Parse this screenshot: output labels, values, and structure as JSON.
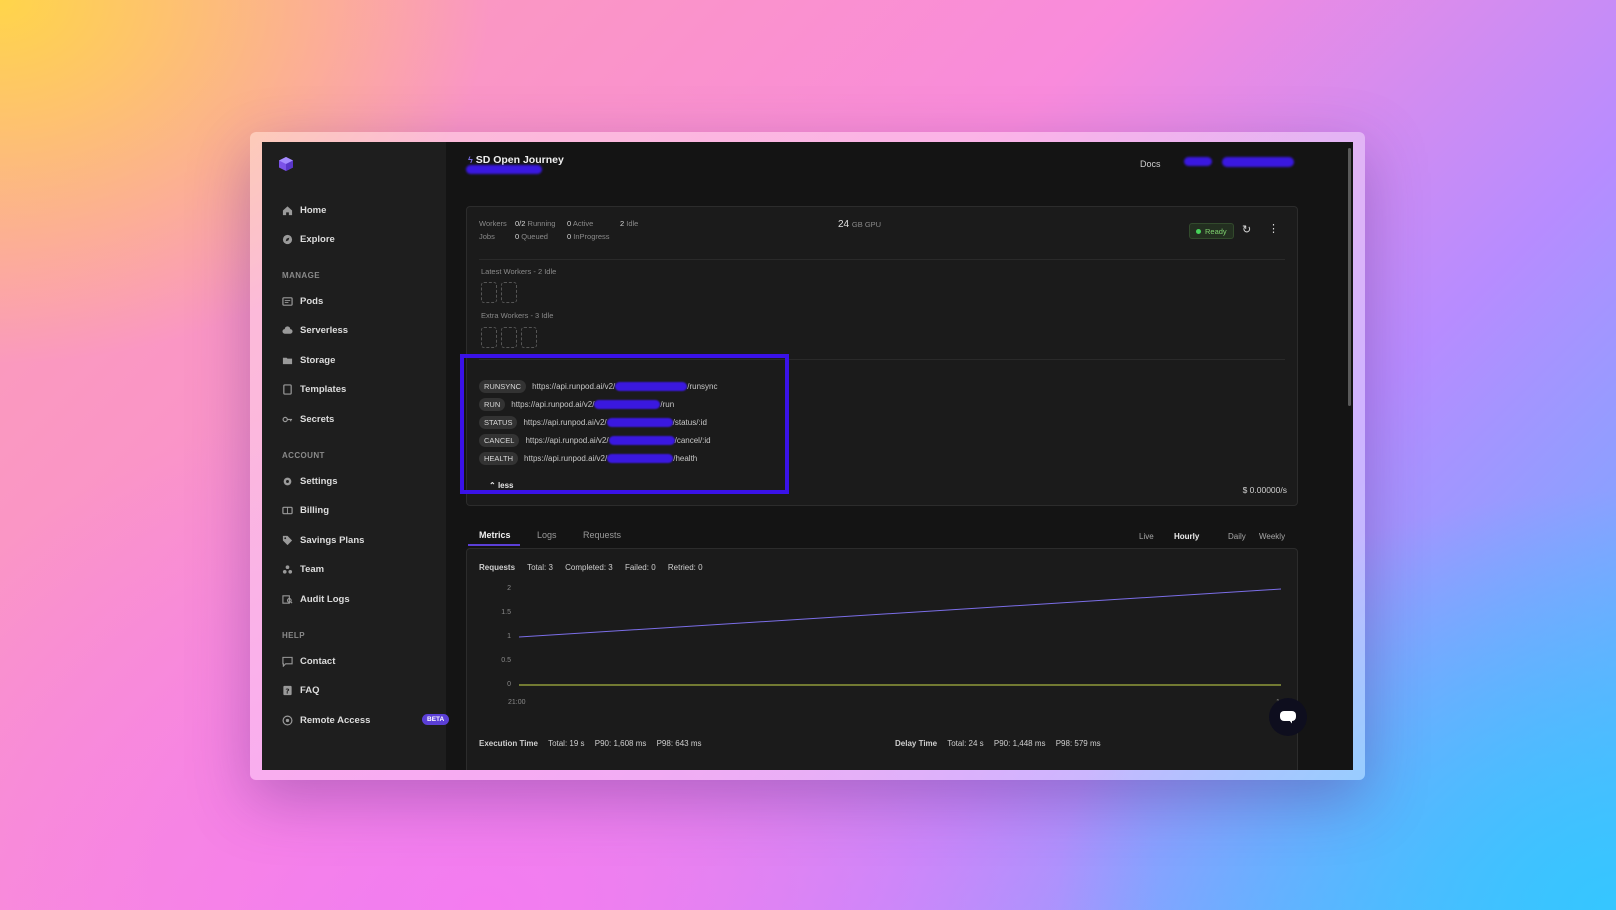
{
  "sidebar": {
    "nav": [
      {
        "label": "Home",
        "icon": "home-icon"
      },
      {
        "label": "Explore",
        "icon": "compass-icon"
      }
    ],
    "manage_title": "MANAGE",
    "manage": [
      {
        "label": "Pods",
        "icon": "pods-icon"
      },
      {
        "label": "Serverless",
        "icon": "cloud-icon"
      },
      {
        "label": "Storage",
        "icon": "storage-icon"
      },
      {
        "label": "Templates",
        "icon": "template-icon"
      },
      {
        "label": "Secrets",
        "icon": "key-icon"
      }
    ],
    "account_title": "ACCOUNT",
    "account": [
      {
        "label": "Settings",
        "icon": "gear-icon"
      },
      {
        "label": "Billing",
        "icon": "billing-icon"
      },
      {
        "label": "Savings Plans",
        "icon": "tag-icon"
      },
      {
        "label": "Team",
        "icon": "team-icon"
      },
      {
        "label": "Audit Logs",
        "icon": "audit-icon"
      }
    ],
    "help_title": "HELP",
    "help": [
      {
        "label": "Contact",
        "icon": "chat-icon"
      },
      {
        "label": "FAQ",
        "icon": "faq-icon"
      },
      {
        "label": "Remote Access",
        "icon": "remote-icon"
      }
    ],
    "beta_label": "BETA"
  },
  "header": {
    "title": "SD Open Journey",
    "docs": "Docs"
  },
  "status": {
    "workers_label": "Workers",
    "running_value": "0/2",
    "running_label": "Running",
    "active_value": "0",
    "active_label": "Active",
    "idle_value": "2",
    "idle_label": "Idle",
    "jobs_label": "Jobs",
    "queued_value": "0",
    "queued_label": "Queued",
    "inprogress_value": "0",
    "inprogress_label": "InProgress",
    "gpu_value": "24",
    "gpu_label": "GB GPU",
    "ready": "Ready"
  },
  "workers": {
    "latest": "Latest Workers - 2 Idle",
    "extra": "Extra Workers - 3 Idle"
  },
  "endpoints": [
    {
      "tag": "RUNSYNC",
      "prefix": "https://api.runpod.ai/v2/",
      "suffix": "/runsync"
    },
    {
      "tag": "RUN",
      "prefix": "https://api.runpod.ai/v2/",
      "suffix": "/run"
    },
    {
      "tag": "STATUS",
      "prefix": "https://api.runpod.ai/v2/",
      "suffix": "/status/:id"
    },
    {
      "tag": "CANCEL",
      "prefix": "https://api.runpod.ai/v2/",
      "suffix": "/cancel/:id"
    },
    {
      "tag": "HEALTH",
      "prefix": "https://api.runpod.ai/v2/",
      "suffix": "/health"
    }
  ],
  "less": "less",
  "cost": "$ 0.00000/s",
  "tabs": [
    "Metrics",
    "Logs",
    "Requests"
  ],
  "ranges": [
    "Live",
    "Hourly",
    "Daily",
    "Weekly"
  ],
  "requests": {
    "title": "Requests",
    "total": "Total: 3",
    "completed": "Completed: 3",
    "failed": "Failed: 0",
    "retried": "Retried: 0"
  },
  "chart_data": {
    "type": "line",
    "x": [
      "21:00",
      "1"
    ],
    "yticks": [
      "2",
      "1.5",
      "1",
      "0.5",
      "0"
    ],
    "ylim": [
      0,
      2
    ],
    "series": [
      {
        "values": [
          1,
          2
        ],
        "color": "#7b6ee8"
      },
      {
        "values": [
          0,
          0
        ],
        "color": "#c8d84a"
      }
    ]
  },
  "execution": {
    "title": "Execution Time",
    "total": "Total: 19 s",
    "p90": "P90: 1,608 ms",
    "p98": "P98: 643 ms"
  },
  "delay": {
    "title": "Delay Time",
    "total": "Total: 24 s",
    "p90": "P90: 1,448 ms",
    "p98": "P98: 579 ms"
  },
  "colors": {
    "accent": "#5b3fd6",
    "highlight": "#3a12e8",
    "ready": "#46d45a"
  }
}
